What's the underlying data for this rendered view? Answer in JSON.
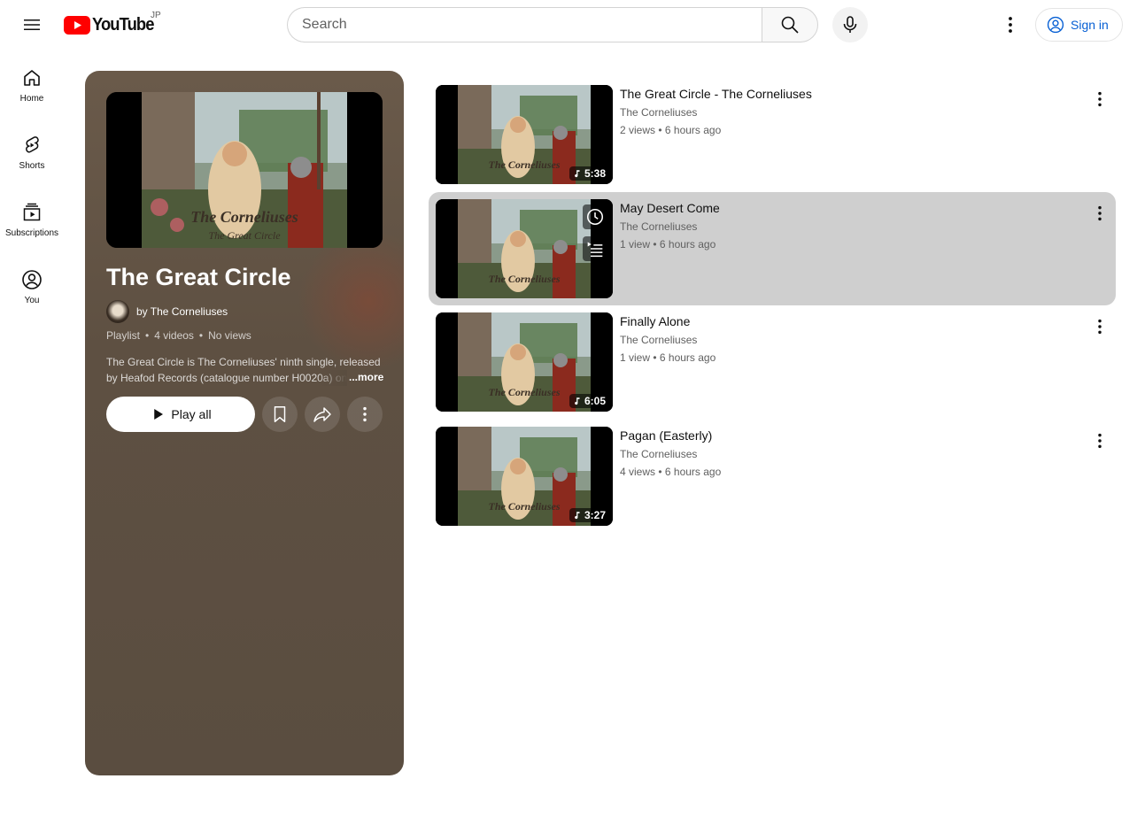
{
  "header": {
    "logo_text": "YouTube",
    "region": "JP",
    "search_placeholder": "Search",
    "signin_label": "Sign in"
  },
  "guide": {
    "items": [
      {
        "label": "Home",
        "icon": "home-icon"
      },
      {
        "label": "Shorts",
        "icon": "shorts-icon"
      },
      {
        "label": "Subscriptions",
        "icon": "subscriptions-icon"
      },
      {
        "label": "You",
        "icon": "you-icon"
      }
    ]
  },
  "playlist": {
    "title": "The Great Circle",
    "by_prefix": "by ",
    "owner": "The Corneliuses",
    "type": "Playlist",
    "video_count": "4 videos",
    "views": "No views",
    "description": "The Great Circle is The Corneliuses' ninth single, released by Heafod Records (catalogue number H0020a) on",
    "more_label": "...more",
    "play_all_label": "Play all",
    "thumb_text_1": "The Corneliuses",
    "thumb_text_2": "The Great Circle"
  },
  "videos": [
    {
      "title": "The Great Circle - The Corneliuses",
      "channel": "The Corneliuses",
      "views": "2 views",
      "age": "6 hours ago",
      "duration": "5:38"
    },
    {
      "title": "May Desert Come",
      "channel": "The Corneliuses",
      "views": "1 view",
      "age": "6 hours ago",
      "duration": ""
    },
    {
      "title": "Finally Alone",
      "channel": "The Corneliuses",
      "views": "1 view",
      "age": "6 hours ago",
      "duration": "6:05"
    },
    {
      "title": "Pagan (Easterly)",
      "channel": "The Corneliuses",
      "views": "4 views",
      "age": "6 hours ago",
      "duration": "3:27"
    }
  ],
  "colors": {
    "accent": "#ff0000",
    "link_blue": "#065fd4",
    "panel_bg": "#5a4d40",
    "hover_row": "#cfcfcf"
  }
}
